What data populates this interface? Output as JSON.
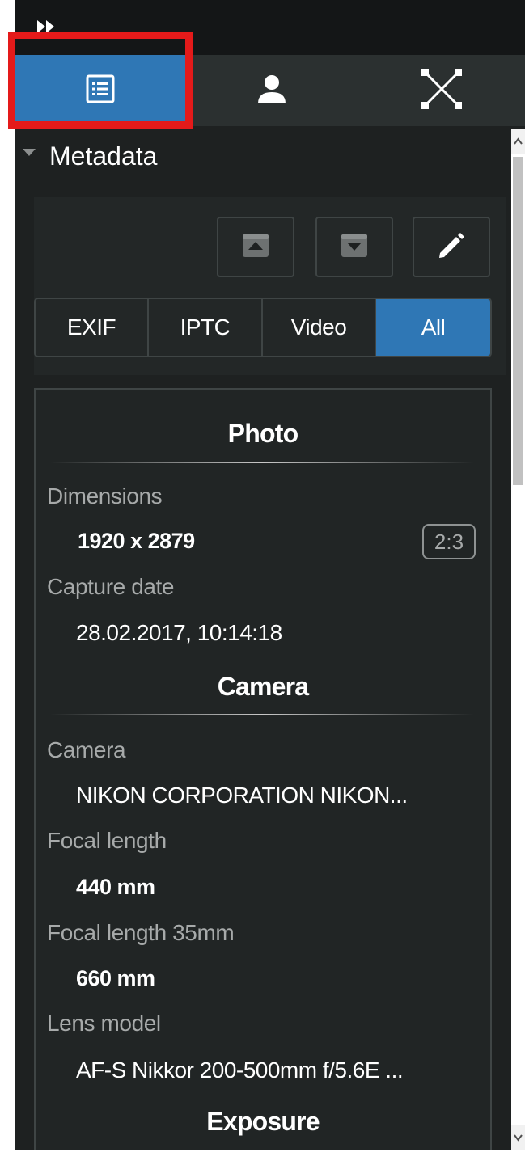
{
  "topbar": {
    "collapse_glyph": "▸▸"
  },
  "tabs": [
    {
      "name": "metadata",
      "icon": "list-icon",
      "active": true
    },
    {
      "name": "people",
      "icon": "person-icon",
      "active": false
    },
    {
      "name": "layout",
      "icon": "expand-arrows-icon",
      "active": false
    }
  ],
  "section": {
    "title": "Metadata"
  },
  "toolbar": {
    "import_icon": "upload-box-icon",
    "export_icon": "download-box-icon",
    "edit_icon": "pencil-icon"
  },
  "filter_tabs": {
    "exif": "EXIF",
    "iptc": "IPTC",
    "video": "Video",
    "all": "All",
    "selected": "All"
  },
  "photo": {
    "title": "Photo",
    "dimensions_label": "Dimensions",
    "dimensions_value": "1920 x 2879",
    "ratio": "2:3",
    "capture_label": "Capture date",
    "capture_value": "28.02.2017, 10:14:18"
  },
  "camera": {
    "title": "Camera",
    "camera_label": "Camera",
    "camera_value": "NIKON CORPORATION NIKON...",
    "focal_label": "Focal length",
    "focal_value": "440 mm",
    "focal35_label": "Focal length 35mm",
    "focal35_value": "660 mm",
    "lens_label": "Lens model",
    "lens_value": "AF-S Nikkor 200-500mm f/5.6E ..."
  },
  "exposure": {
    "title": "Exposure"
  },
  "colors": {
    "accent": "#2f77b5",
    "highlight": "#e41a1a",
    "panel": "#1e2121"
  }
}
